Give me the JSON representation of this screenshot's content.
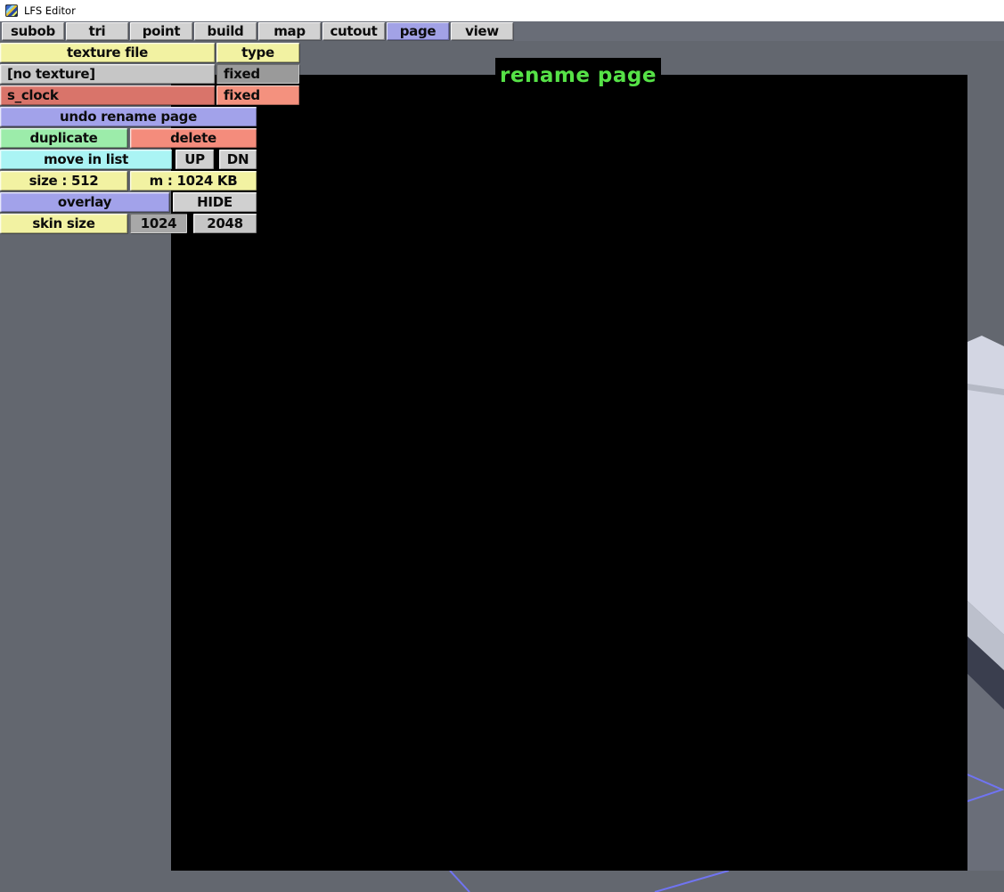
{
  "window": {
    "title": "LFS Editor"
  },
  "tabs": [
    {
      "label": "subob",
      "active": false
    },
    {
      "label": "tri",
      "active": false
    },
    {
      "label": "point",
      "active": false
    },
    {
      "label": "build",
      "active": false
    },
    {
      "label": "map",
      "active": false
    },
    {
      "label": "cutout",
      "active": false
    },
    {
      "label": "page",
      "active": true
    },
    {
      "label": "view",
      "active": false
    }
  ],
  "texture_panel": {
    "headers": {
      "file": "texture file",
      "type": "type"
    },
    "rows": [
      {
        "file": "[no texture]",
        "type": "fixed",
        "selected": false
      },
      {
        "file": "s_clock",
        "type": "fixed",
        "selected": true
      }
    ],
    "undo_button": "undo rename page",
    "duplicate_button": "duplicate",
    "delete_button": "delete",
    "move_in_list_label": "move in list",
    "up_button": "UP",
    "down_button": "DN",
    "size_label": "size : 512",
    "memory_label": "m : 1024 KB",
    "overlay_button": "overlay",
    "hide_button": "HIDE",
    "skin_size_label": "skin size",
    "skin_1024_button": "1024",
    "skin_2048_button": "2048"
  },
  "viewport": {
    "page_title": "rename page"
  },
  "colors": {
    "background_gray": "#63676F",
    "viewport_black": "#000000",
    "panel_yellow": "#f2f2a2",
    "panel_purple": "#a2a2ea",
    "panel_green": "#9cecaa",
    "panel_red": "#f48c7c",
    "panel_cyan": "#aaf4f4",
    "selected_row_red": "#d9746a",
    "selected_type_red": "#f4917e",
    "tab_selected_purple": "#a2a2e6",
    "rename_title_green": "#56e247",
    "tower_face_light": "#d3d6e3",
    "wireframe_blue": "#7074f2"
  }
}
